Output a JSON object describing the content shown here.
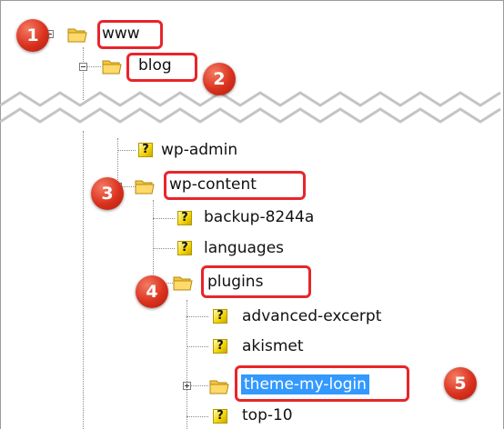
{
  "tree": {
    "www": "www",
    "blog": "blog",
    "wp_admin": "wp-admin",
    "wp_content": "wp-content",
    "backup": "backup-8244a",
    "languages": "languages",
    "plugins": "plugins",
    "advanced_excerpt": "advanced-excerpt",
    "akismet": "akismet",
    "theme_my_login": "theme-my-login",
    "top_10": "top-10"
  },
  "badges": [
    "1",
    "2",
    "3",
    "4",
    "5"
  ],
  "icons": {
    "folder": "folder-icon",
    "unknown": "question-mark-icon",
    "expand": "plus-expander-icon",
    "collapse": "minus-expander-icon"
  },
  "colors": {
    "highlight_box": "#e8252b",
    "badge": "#d9311e",
    "selection": "#3399ff",
    "folder": "#f4c542"
  }
}
